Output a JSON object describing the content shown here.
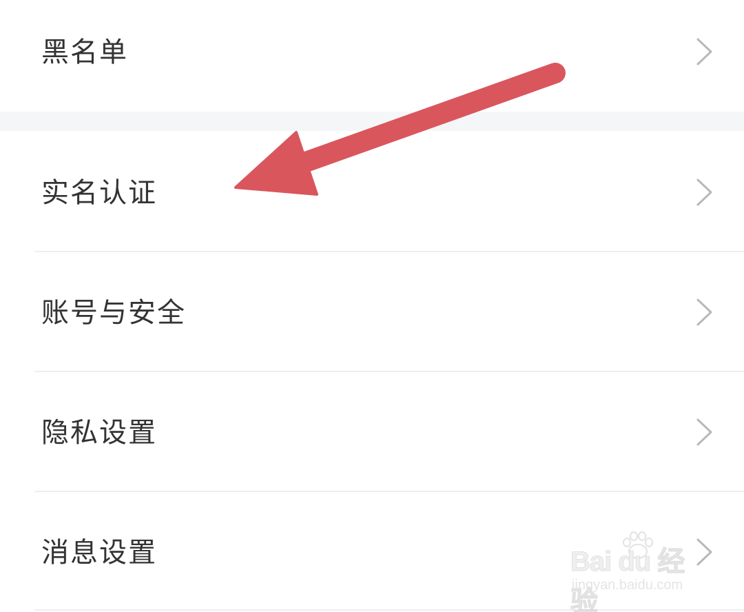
{
  "settings": {
    "items": [
      {
        "label": "黑名单",
        "icon": "chevron-right-icon"
      },
      {
        "label": "实名认证",
        "icon": "chevron-right-icon"
      },
      {
        "label": "账号与安全",
        "icon": "chevron-right-icon"
      },
      {
        "label": "隐私设置",
        "icon": "chevron-right-icon"
      },
      {
        "label": "消息设置",
        "icon": "chevron-right-icon"
      }
    ]
  },
  "annotation": {
    "type": "pointer-arrow",
    "color": "#d9565d",
    "points_to": "实名认证"
  },
  "watermark": {
    "brand": "Bai du 经验",
    "url": "jingyan.baidu.com"
  },
  "colors": {
    "background": "#ffffff",
    "section_gap": "#f5f6f7",
    "text": "#333333",
    "chevron": "#b8b8b8",
    "divider": "#eeeeee"
  }
}
